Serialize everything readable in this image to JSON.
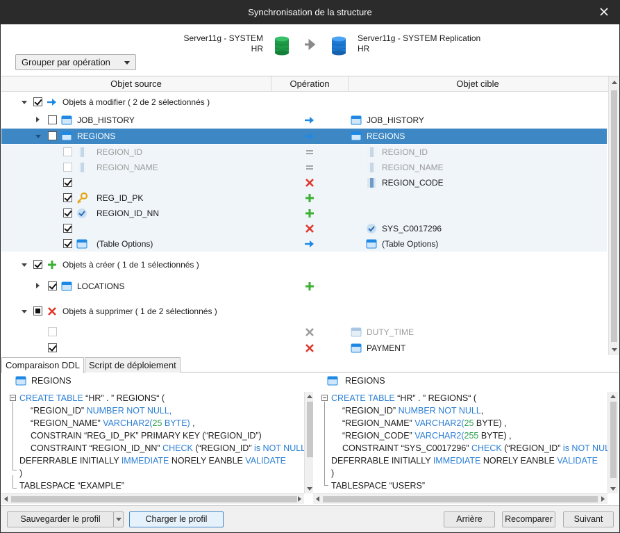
{
  "window": {
    "title": "Synchronisation de la structure"
  },
  "header": {
    "source_server": "Server11g - SYSTEM",
    "source_schema": "HR",
    "target_server": "Server11g - SYSTEM Replication",
    "target_schema": "HR",
    "group_select": "Grouper par opération"
  },
  "grid": {
    "columns": {
      "source": "Objet source",
      "operation": "Opération",
      "target": "Objet cible"
    },
    "groups": {
      "modify": "Objets à modifier ( 2 de 2 sélectionnés )",
      "create": "Objets à créer ( 1 de 1 sélectionnés )",
      "delete": "Objets à supprimer ( 1 de 2 sélectionnés )"
    },
    "rows": {
      "job_history_src": "JOB_HISTORY",
      "job_history_tgt": "JOB_HISTORY",
      "regions_src": "REGIONS",
      "regions_tgt": "REGIONS",
      "region_id_src": "REGION_ID",
      "region_id_tgt": "REGION_ID",
      "region_name_src": "REGION_NAME",
      "region_name_tgt": "REGION_NAME",
      "region_code_tgt": "REGION_CODE",
      "reg_id_pk_src": "REG_ID_PK",
      "region_id_nn_src": "REGION_ID_NN",
      "sys_c_tgt": "SYS_C0017296",
      "table_options_src": "(Table Options)",
      "table_options_tgt": "(Table Options)",
      "locations_src": "LOCATIONS",
      "duty_time_tgt": "DUTY_TIME",
      "payment_tgt": "PAYMENT"
    }
  },
  "tabs": {
    "ddl": "Comparaison DDL",
    "script": "Script de déploiement"
  },
  "ddl_left": {
    "title": "REGIONS",
    "l1_kw": "CREATE TABLE",
    "l1_txt": " “HR” . ” REGIONS“ (",
    "l2_txt": "“REGION_ID” ",
    "l2_kw": "NUMBER NOT NULL,",
    "l3_txt": "“REGION_NAME” ",
    "l3_kw": "VARCHAR2(",
    "l3_num": "25",
    "l3_kw2": " BYTE)",
    "l3_end": " ,",
    "l4_txt": "CONSTRAIN “REG_ID_PK” PRIMARY KEY (“REGION_ID”)",
    "l5_txt": "CONSTRAINT “REGION_ID_NN” ",
    "l5_kw": "CHECK",
    "l5_txt2": " (“REGION_ID” ",
    "l5_kw2": "is NOT NULL",
    "l5_txt3": ") ",
    "l5_kw3": "NO",
    "l6_txt": "DEFERRABLE INITIALLY ",
    "l6_kw": "IMMEDIATE",
    "l6_txt2": " NORELY EANBLE ",
    "l6_kw2": "VALIDATE",
    "l7_txt": ")",
    "l8_txt": "TABLESPACE “EXAMPLE”"
  },
  "ddl_right": {
    "title": "REGIONS",
    "l1_kw": "CREATE TABLE",
    "l1_txt": " “HR” . ” REGIONS“ (",
    "l2_txt": "“REGION_ID” ",
    "l2_kw": "NUMBER NOT NULL",
    "l2_end": ",",
    "l3_txt": "“REGION_NAME” ",
    "l3_kw": "VARCHAR2(",
    "l3_num": "25",
    "l3_txt2": " BYTE) ,",
    "l4_txt": "“REGION_CODE” ",
    "l4_kw": "VARCHAR2(",
    "l4_num": "255",
    "l4_txt2": " BYTE) ,",
    "l5_txt": "CONSTRAINT “SYS_C0017296” ",
    "l5_kw": "CHECK",
    "l5_txt2": " (“REGION_ID” ",
    "l5_kw2": "is NOT NULL",
    "l5_txt3": ") N",
    "l6_txt": "DEFERRABLE INITIALLY ",
    "l6_kw": "IMMEDIATE",
    "l6_txt2": " NORELY EANBLE ",
    "l6_kw2": "VALIDATE",
    "l7_txt": ")",
    "l8_txt": "TABLESPACE “USERS”"
  },
  "footer": {
    "save_profile": "Sauvegarder le profil",
    "load_profile": "Charger le profil",
    "back": "Arrière",
    "recompare": "Recomparer",
    "next": "Suivant"
  },
  "colors": {
    "accent": "#3d87c4",
    "add": "#3cb034",
    "remove": "#e0382c",
    "keyword": "#2a7ed4",
    "number": "#2b9e4d"
  }
}
